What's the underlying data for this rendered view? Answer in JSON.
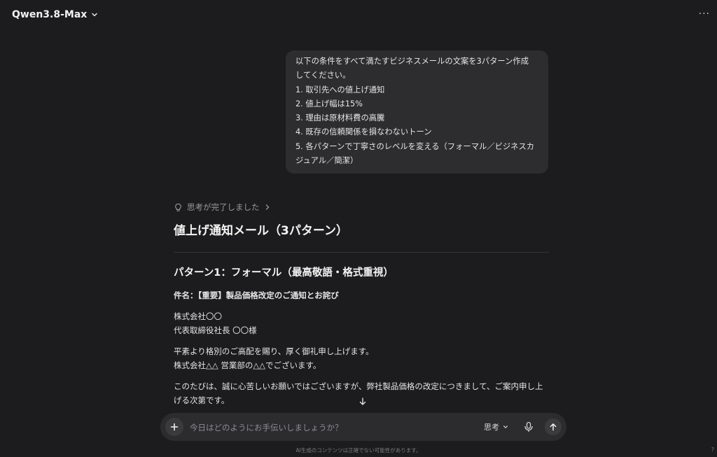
{
  "header": {
    "model_name": "Qwen3.8-Max",
    "more_label": "···"
  },
  "user_message": {
    "lines": [
      "以下の条件をすべて満たすビジネスメールの文案を3パターン作成",
      "してください。",
      "1. 取引先への値上げ通知",
      "2. 値上げ幅は15%",
      "3. 理由は原材料費の高騰",
      "4. 既存の信頼関係を損なわないトーン",
      "5. 各パターンで丁寧さのレベルを変える（フォーマル／ビジネスカ",
      "ジュアル／簡潔）"
    ]
  },
  "assistant": {
    "thinking_label": "思考が完了しました",
    "title": "値上げ通知メール（3パターン）",
    "pattern1_heading": "パターン1：フォーマル（最高敬語・格式重視）",
    "subject": "件名：【重要】製品価格改定のご通知とお詫び",
    "recipient_company": "株式会社〇〇",
    "recipient_name": "代表取締役社長 〇〇様",
    "greeting_1": "平素より格別のご高配を賜り、厚く御礼申し上げます。",
    "greeting_2": "株式会社△△ 営業部の△△でございます。",
    "body_1": "このたびは、誠に心苦しいお願いではございますが、弊社製品価格の改定につきまして、ご案内申し上",
    "body_2": "げる次第です。"
  },
  "input": {
    "placeholder": "今日はどのようにお手伝いしましょうか？",
    "value": "",
    "think_label": "思考"
  },
  "footer": {
    "disclaimer": "AI生成のコンテンツは正確でない可能性があります。",
    "help": "?"
  }
}
